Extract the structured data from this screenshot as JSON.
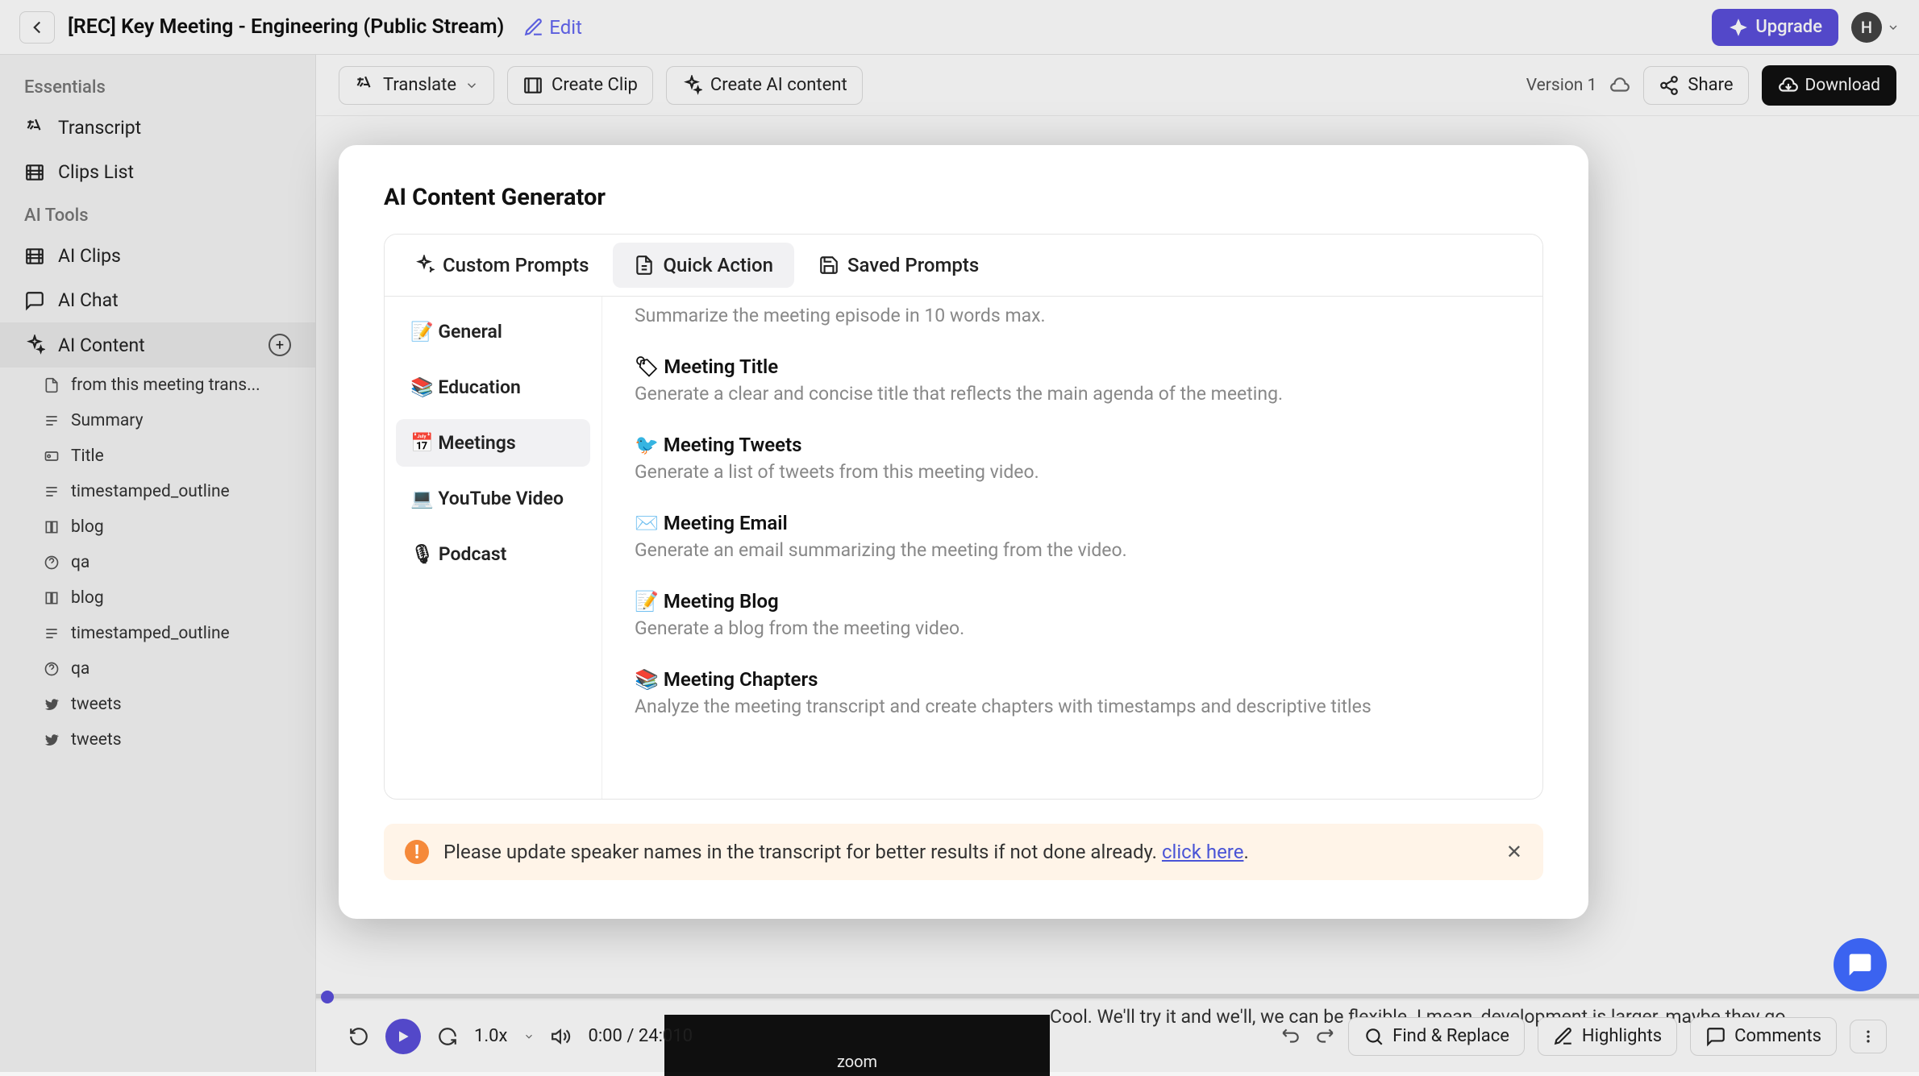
{
  "header": {
    "title": "[REC] Key Meeting - Engineering (Public Stream)",
    "edit": "Edit",
    "upgrade": "Upgrade",
    "avatar_letter": "H"
  },
  "sidebar": {
    "sections": {
      "essentials": "Essentials",
      "aiTools": "AI Tools"
    },
    "transcript": "Transcript",
    "clipsList": "Clips List",
    "aiClips": "AI Clips",
    "aiChat": "AI Chat",
    "aiContent": "AI Content",
    "items": [
      "from this meeting trans...",
      "Summary",
      "Title",
      "timestamped_outline",
      "blog",
      "qa",
      "blog",
      "timestamped_outline",
      "qa",
      "tweets",
      "tweets"
    ]
  },
  "toolbar": {
    "translate": "Translate",
    "createClip": "Create Clip",
    "createAI": "Create AI content",
    "version": "Version 1",
    "share": "Share",
    "download": "Download"
  },
  "transcript_snippet": "Cool. We'll try it and we'll, we can be flexible. I mean, development is larger, maybe they go",
  "video_brand": "zoom",
  "player": {
    "speed": "1.0x",
    "time": "0:00 / 24:010",
    "findReplace": "Find & Replace",
    "highlights": "Highlights",
    "comments": "Comments"
  },
  "modal": {
    "title": "AI Content Generator",
    "tabs": {
      "custom": "Custom Prompts",
      "quick": "Quick Action",
      "saved": "Saved Prompts"
    },
    "categories": [
      "📝 General",
      "📚 Education",
      "📅 Meetings",
      "💻 YouTube Video",
      "🎙 Podcast"
    ],
    "prompts": [
      {
        "title": "",
        "desc": "Summarize the meeting episode in 10 words max."
      },
      {
        "title": "🏷 Meeting Title",
        "desc": "Generate a clear and concise title that reflects the main agenda of the meeting."
      },
      {
        "title": "🐦 Meeting Tweets",
        "desc": "Generate a list of tweets from this meeting video."
      },
      {
        "title": "✉️ Meeting Email",
        "desc": "Generate an email summarizing the meeting from the video."
      },
      {
        "title": "📝 Meeting Blog",
        "desc": "Generate a blog from the meeting video."
      },
      {
        "title": "📚 Meeting Chapters",
        "desc": "Analyze the meeting transcript and create chapters with timestamps and descriptive titles"
      }
    ],
    "warning": {
      "text": "Please update speaker names in the transcript for better results if not done already. ",
      "link": "click here",
      "after": "."
    }
  }
}
